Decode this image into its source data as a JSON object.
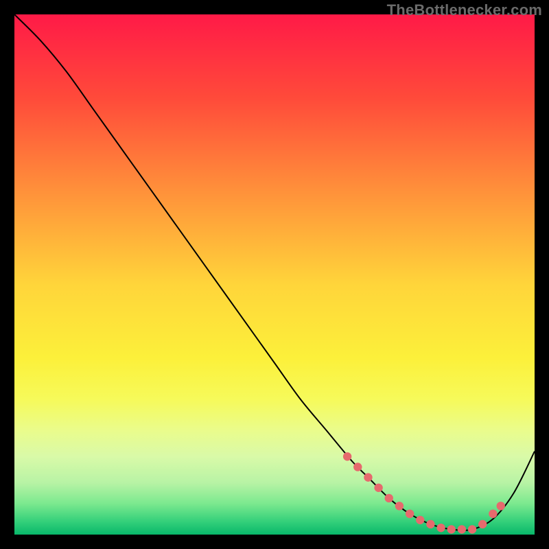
{
  "attribution": "TheBottlenecker.com",
  "colors": {
    "frame": "#000000",
    "curve_stroke": "#000000",
    "marker_fill": "#e66a6d",
    "marker_stroke": "#d8555a",
    "gradient_stops": [
      {
        "pct": 0,
        "color": "#ff1a47"
      },
      {
        "pct": 16,
        "color": "#ff4a3a"
      },
      {
        "pct": 34,
        "color": "#ff913a"
      },
      {
        "pct": 52,
        "color": "#ffd53a"
      },
      {
        "pct": 66,
        "color": "#fcf03a"
      },
      {
        "pct": 74,
        "color": "#f6fa5a"
      },
      {
        "pct": 80,
        "color": "#eafc8c"
      },
      {
        "pct": 85,
        "color": "#d9faa8"
      },
      {
        "pct": 90,
        "color": "#b8f3a5"
      },
      {
        "pct": 94,
        "color": "#7ce98f"
      },
      {
        "pct": 97.5,
        "color": "#34d07a"
      },
      {
        "pct": 100,
        "color": "#08b76a"
      }
    ]
  },
  "chart_data": {
    "type": "line",
    "title": "",
    "xlabel": "",
    "ylabel": "",
    "xlim": [
      0,
      100
    ],
    "ylim": [
      0,
      100
    ],
    "grid": false,
    "legend": false,
    "series": [
      {
        "name": "curve",
        "x": [
          0,
          5,
          10,
          15,
          20,
          25,
          30,
          35,
          40,
          45,
          50,
          55,
          60,
          65,
          68,
          72,
          76,
          80,
          84,
          88,
          92,
          96,
          100
        ],
        "y": [
          100,
          95,
          89,
          82,
          75,
          68,
          61,
          54,
          47,
          40,
          33,
          26,
          20,
          14,
          11,
          7,
          4,
          2,
          1,
          1,
          3,
          8,
          16
        ]
      }
    ],
    "markers": {
      "name": "optimal-range",
      "x": [
        64,
        66,
        68,
        70,
        72,
        74,
        76,
        78,
        80,
        82,
        84,
        86,
        88,
        90,
        92,
        93.5
      ],
      "y": [
        15,
        13,
        11,
        9,
        7,
        5.5,
        4,
        2.8,
        2,
        1.3,
        1,
        1,
        1,
        2,
        4,
        5.5
      ]
    }
  }
}
